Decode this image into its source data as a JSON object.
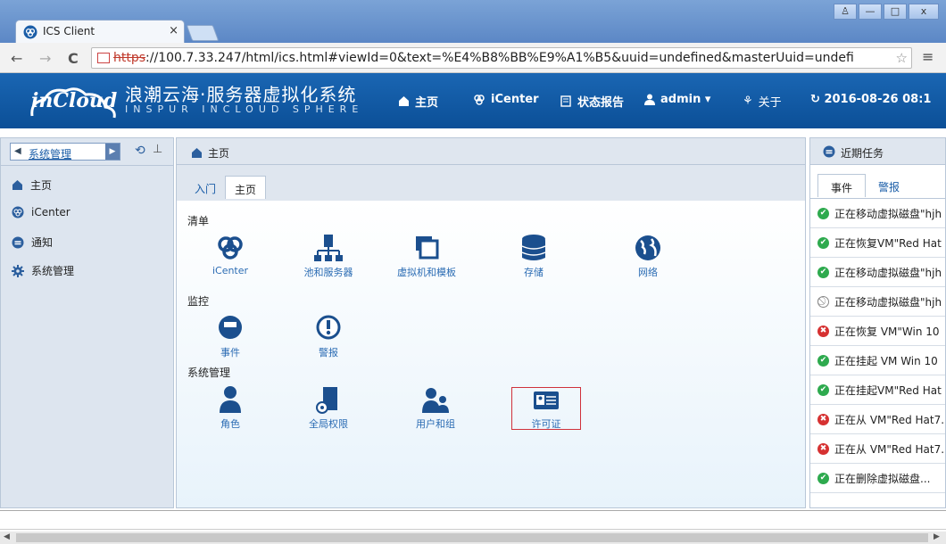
{
  "browser": {
    "tab_title": "ICS Client",
    "tab_close": "×",
    "url_protocol": "https",
    "url_rest": "://100.7.33.247/html/ics.html#viewId=0&text=%E4%B8%BB%E9%A1%B5&uuid=undefined&masterUuid=undefi",
    "nav_back": "←",
    "nav_forward": "→",
    "nav_reload": "C",
    "star": "☆",
    "menu": "≡",
    "win_minimize": "—",
    "win_maximize": "□",
    "win_close": "x",
    "win_user": "♙"
  },
  "header": {
    "logo": "inCloud",
    "system_name": "浪潮云海·服务器虚拟化系统",
    "system_sub": "INSPUR INCLOUD SPHERE",
    "nav": [
      {
        "icon": "home-icon",
        "label": "主页"
      },
      {
        "icon": "icenter-icon",
        "label": "iCenter"
      },
      {
        "icon": "report-icon",
        "label": "状态报告"
      },
      {
        "icon": "user-icon",
        "label": "admin ▾"
      },
      {
        "icon": "about-icon",
        "label": "关于"
      }
    ],
    "datetime": "2016-08-26 08:1"
  },
  "sidebar": {
    "selector": "系统管理",
    "items": [
      {
        "icon": "home-icon",
        "label": "主页"
      },
      {
        "icon": "icenter-icon",
        "label": "iCenter"
      },
      {
        "icon": "notification-icon",
        "label": "通知"
      },
      {
        "icon": "gear-icon",
        "label": "系统管理"
      }
    ]
  },
  "main": {
    "title": "主页",
    "tabs": [
      "入门",
      "主页"
    ],
    "sections": {
      "inventory": "清单",
      "monitor": "监控",
      "admin": "系统管理"
    },
    "inventory_items": [
      "iCenter",
      "池和服务器",
      "虚拟机和模板",
      "存储",
      "网络"
    ],
    "monitor_items": [
      "事件",
      "警报"
    ],
    "admin_items": [
      "角色",
      "全局权限",
      "用户和组",
      "许可证"
    ]
  },
  "right_panel": {
    "title": "近期任务",
    "tabs": [
      "事件",
      "警报"
    ],
    "tasks": [
      {
        "status": "ok",
        "text": "正在移动虚拟磁盘\"hjh"
      },
      {
        "status": "ok",
        "text": "正在恢复VM\"Red Hat"
      },
      {
        "status": "ok",
        "text": "正在移动虚拟磁盘\"hjh"
      },
      {
        "status": "cancel",
        "text": "正在移动虚拟磁盘\"hjh"
      },
      {
        "status": "err",
        "text": "正在恢复 VM\"Win 10"
      },
      {
        "status": "ok",
        "text": "正在挂起 VM Win 10"
      },
      {
        "status": "ok",
        "text": "正在挂起VM\"Red Hat"
      },
      {
        "status": "err",
        "text": "正在从 VM\"Red Hat7."
      },
      {
        "status": "err",
        "text": "正在从 VM\"Red Hat7."
      },
      {
        "status": "ok",
        "text": "正在删除虚拟磁盘..."
      }
    ]
  },
  "colors": {
    "header_bg": "#0b4f97",
    "link": "#2a6bb3",
    "ok": "#2eaa4e",
    "error": "#d63131",
    "highlight_border": "#d0313b"
  }
}
